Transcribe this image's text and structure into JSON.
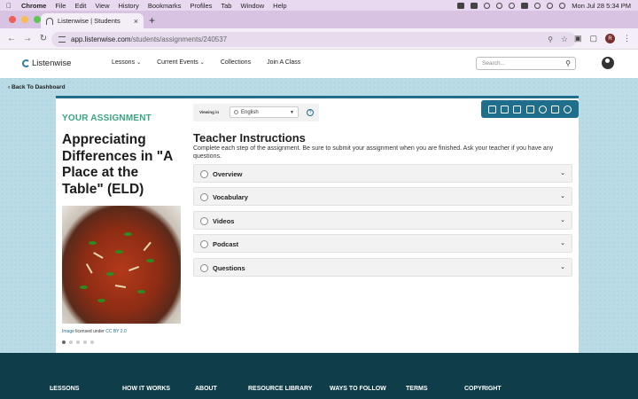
{
  "menubar": {
    "app": "Chrome",
    "items": [
      "File",
      "Edit",
      "View",
      "History",
      "Bookmarks",
      "Profiles",
      "Tab",
      "Window",
      "Help"
    ],
    "clock": "Mon Jul 28  5:34 PM"
  },
  "browser": {
    "tab_title": "Listenwise | Students",
    "url_host": "app.listenwise.com",
    "url_path": "/students/assignments/240537",
    "profile_initial": "R"
  },
  "site": {
    "logo": "Listenwise",
    "nav": [
      {
        "label": "Lessons",
        "dropdown": true
      },
      {
        "label": "Current Events",
        "dropdown": true
      },
      {
        "label": "Collections",
        "dropdown": false
      },
      {
        "label": "Join A Class",
        "dropdown": false
      }
    ],
    "search_placeholder": "Search..."
  },
  "back_link": "Back To Dashboard",
  "assignment": {
    "heading": "YOUR ASSIGNMENT",
    "title": "Appreciating Differences in \"A Place at the Table\" (ELD)",
    "caption_link": "Image",
    "caption_text": " licensed under ",
    "caption_license": "CC BY 2.0",
    "carousel_active_index": 0,
    "carousel_count": 5
  },
  "viewing": {
    "label": "Viewing in",
    "language": "English"
  },
  "toolbar_icons": [
    "play-icon",
    "stop-icon",
    "pause-icon",
    "book-icon",
    "globe-icon",
    "notes-icon",
    "settings-icon"
  ],
  "instructions": {
    "title": "Teacher Instructions",
    "text": "Complete each step of the assignment. Be sure to submit your assignment when you are finished. Ask your teacher if you have any questions."
  },
  "steps": [
    "Overview",
    "Vocabulary",
    "Videos",
    "Podcast",
    "Questions"
  ],
  "footer": [
    "LESSONS",
    "HOW IT WORKS",
    "ABOUT",
    "RESOURCE LIBRARY",
    "WAYS TO FOLLOW",
    "TERMS",
    "COPYRIGHT"
  ],
  "colors": {
    "accent_green": "#39a77e",
    "brand_teal": "#1f6e8c",
    "footer_bg": "#0f3d49"
  }
}
